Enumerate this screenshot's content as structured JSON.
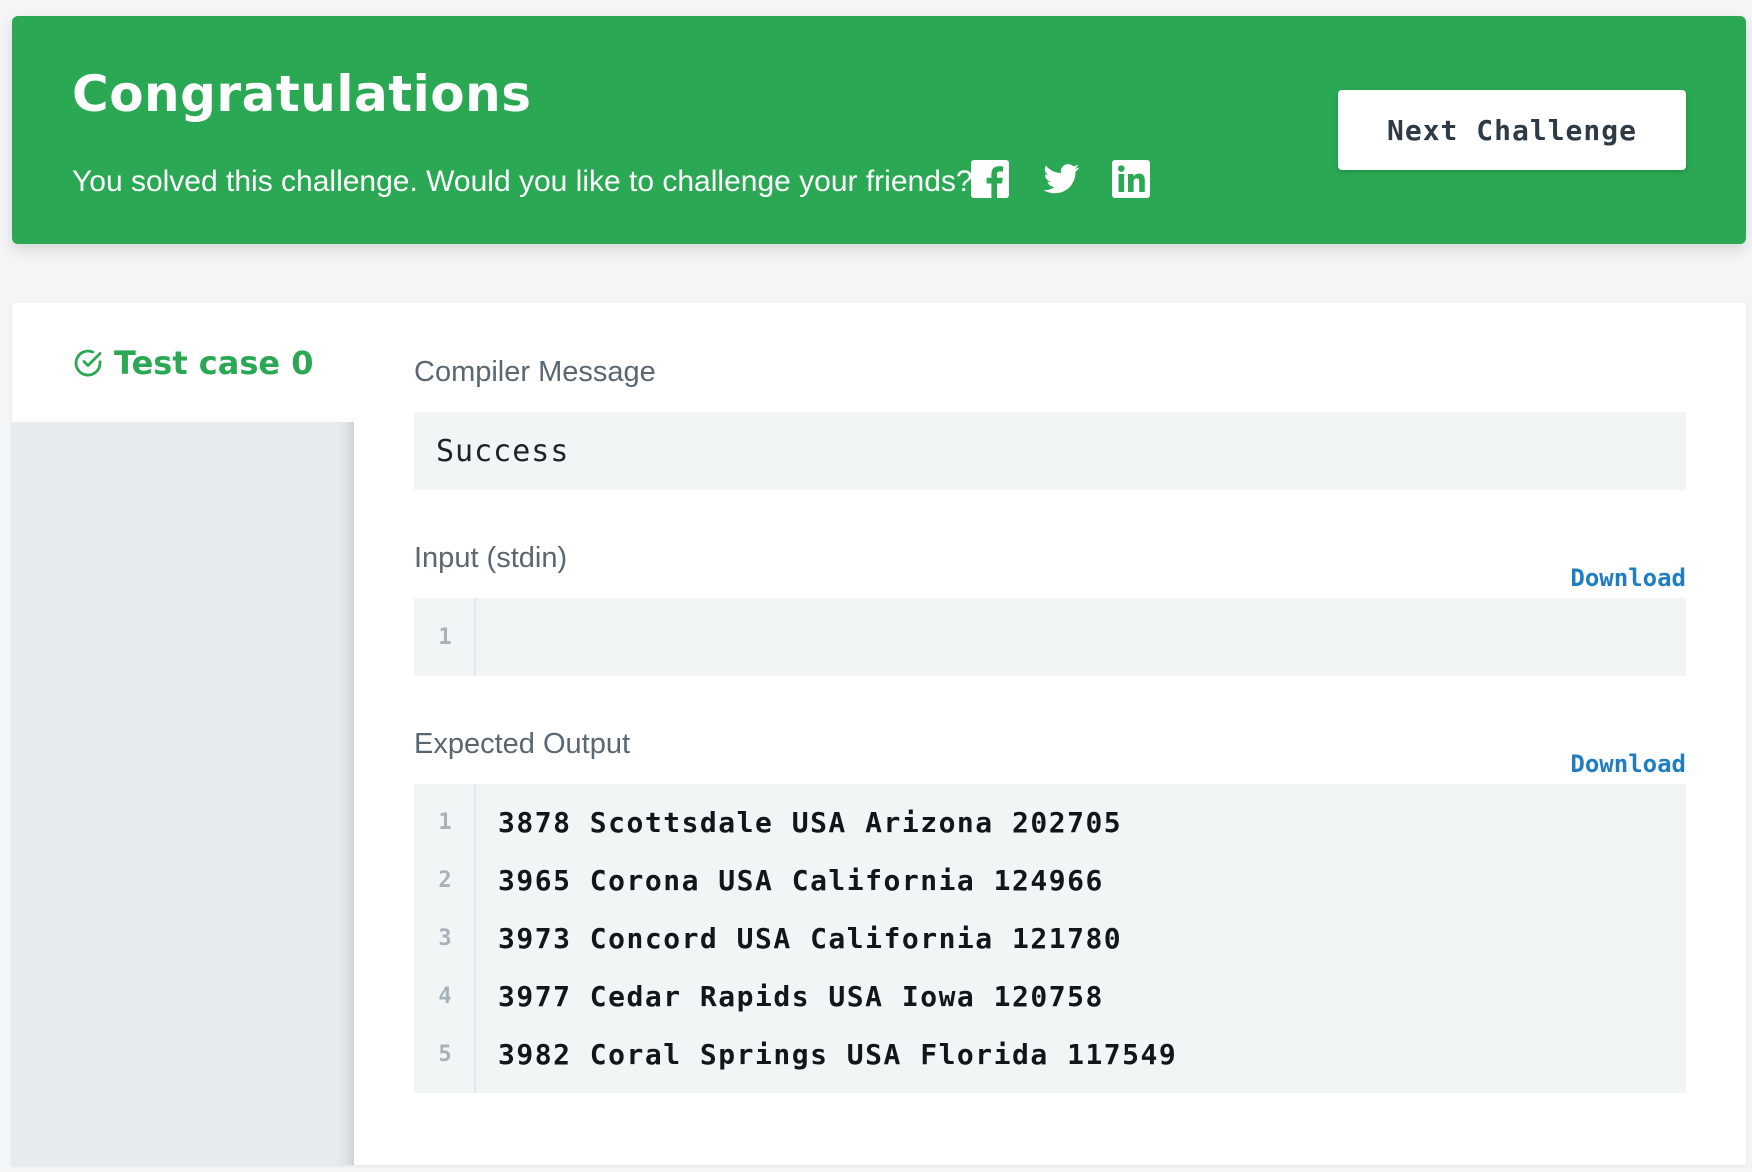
{
  "banner": {
    "title": "Congratulations",
    "subtitle": "You solved this challenge. Would you like to challenge your friends?",
    "share_icons": [
      "facebook-icon",
      "twitter-icon",
      "linkedin-icon"
    ],
    "next_button": "Next Challenge",
    "colors": {
      "background": "#2aa853",
      "text": "#ffffff"
    }
  },
  "sidebar": {
    "tabs": [
      {
        "label": "Test case 0",
        "icon": "check-circle-icon",
        "status": "passed"
      }
    ]
  },
  "compiler": {
    "label": "Compiler Message",
    "message": "Success"
  },
  "input": {
    "label": "Input (stdin)",
    "download": "Download",
    "lines": [
      {
        "no": "1",
        "text": ""
      }
    ]
  },
  "expected": {
    "label": "Expected Output",
    "download": "Download",
    "lines": [
      {
        "no": "1",
        "text": "3878 Scottsdale USA Arizona 202705"
      },
      {
        "no": "2",
        "text": "3965 Corona USA California 124966"
      },
      {
        "no": "3",
        "text": "3973 Concord USA California 121780"
      },
      {
        "no": "4",
        "text": "3977 Cedar Rapids USA Iowa 120758"
      },
      {
        "no": "5",
        "text": "3982 Coral Springs USA Florida 117549"
      }
    ]
  },
  "theme": {
    "accent": "#2aa853",
    "link": "#1f7ec1"
  }
}
